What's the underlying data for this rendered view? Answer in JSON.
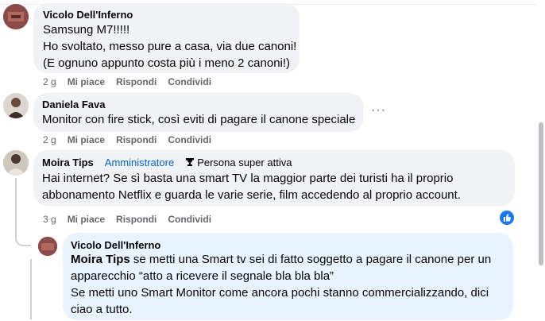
{
  "comments": [
    {
      "author": "Vicolo Dell'Inferno",
      "lines": [
        "Samsung M7!!!!!",
        "Ho svoltato, messo pure a casa, via due canoni!",
        "(E ognuno appunto costa più i meno 2 canoni!)"
      ],
      "time": "2 g",
      "like": "Mi piace",
      "reply": "Rispondi",
      "share": "Condividi"
    },
    {
      "author": "Daniela Fava",
      "lines": [
        "Monitor con fire stick, così eviti di pagare il canone speciale"
      ],
      "time": "2 g",
      "like": "Mi piace",
      "reply": "Rispondi",
      "share": "Condividi",
      "more": "···"
    },
    {
      "author": "Moira Tips",
      "role": "Amministratore",
      "badge": "Persona super attiva",
      "lines": [
        "Hai internet? Se sì basta una smart TV la maggior parte dei turisti ha il proprio",
        "abbonamento Netflix e guarda le varie serie, film accedendo al proprio account."
      ],
      "time": "3 g",
      "like": "Mi piace",
      "reply": "Rispondi",
      "share": "Condividi"
    }
  ],
  "reply": {
    "author": "Vicolo Dell'Inferno",
    "mention": "Moira Tips",
    "line1_rest": " se metti una Smart tv sei di fatto soggetto a pagare il canone per un",
    "lines": [
      "apparecchio “atto a ricevere il segnale bla bla bla”",
      "Se metti uno Smart Monitor come ancora pochi stanno commercializzando, dici",
      "ciao a tutto."
    ]
  },
  "colors": {
    "accent": "#1877f2",
    "bubble": "#f0f2f5",
    "highlight": "#e7f3ff",
    "meta": "#65676b"
  },
  "icons": [
    "trophy-icon",
    "thumbs-up-icon",
    "more-options-icon"
  ]
}
